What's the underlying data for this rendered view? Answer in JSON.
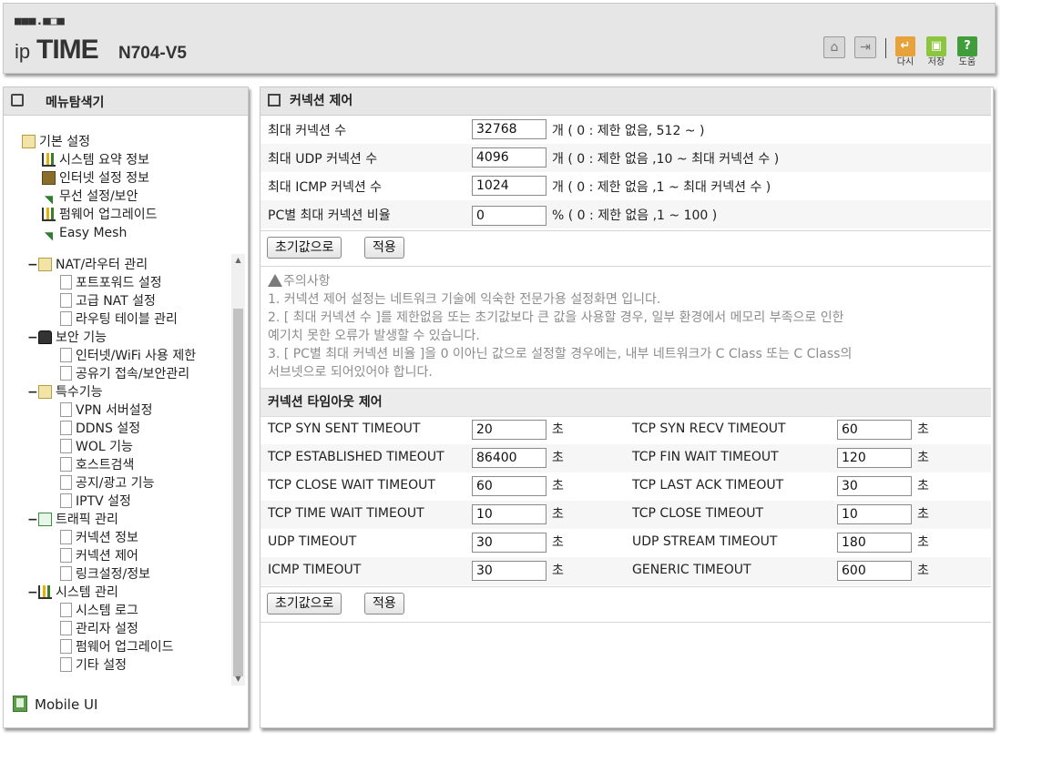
{
  "header": {
    "brand_dots": "■■■.■□■",
    "brand_ip": "ip",
    "brand_time": "TIME",
    "model": "N704-V5",
    "actions": [
      {
        "label": "다시",
        "color": "#e8a23a"
      },
      {
        "label": "저장",
        "color": "#8cc63f"
      },
      {
        "label": "도움",
        "color": "#3f9e3a"
      }
    ]
  },
  "sidebar": {
    "title": "메뉴탐색기",
    "basic": {
      "label": "기본 설정",
      "items": [
        "시스템 요약 정보",
        "인터넷 설정 정보",
        "무선 설정/보안",
        "펌웨어 업그레이드",
        "Easy Mesh"
      ]
    },
    "groups": [
      {
        "toggle": "−",
        "label": "NAT/라우터 관리",
        "items": [
          "포트포워드 설정",
          "고급 NAT 설정",
          "라우팅 테이블 관리"
        ]
      },
      {
        "toggle": "−",
        "label": "보안 기능",
        "items": [
          "인터넷/WiFi 사용 제한",
          "공유기 접속/보안관리"
        ]
      },
      {
        "toggle": "−",
        "label": "특수기능",
        "items": [
          "VPN 서버설정",
          "DDNS 설정",
          "WOL 기능",
          "호스트검색",
          "공지/광고 기능",
          "IPTV 설정"
        ]
      },
      {
        "toggle": "−",
        "label": "트래픽 관리",
        "items": [
          "커넥션 정보",
          "커넥션 제어",
          "링크설정/정보"
        ]
      },
      {
        "toggle": "−",
        "label": "시스템 관리",
        "items": [
          "시스템 로그",
          "관리자 설정",
          "펌웨어 업그레이드",
          "기타 설정"
        ]
      }
    ],
    "mobile_ui": "Mobile UI"
  },
  "main": {
    "title": "커넥션 제어",
    "limits": [
      {
        "label": "최대 커넥션 수",
        "value": "32768",
        "suffix": "개 ( 0 : 제한 없음, 512 ~ )"
      },
      {
        "label": "최대 UDP 커넥션 수",
        "value": "4096",
        "suffix": "개 ( 0 : 제한 없음 ,10 ~ 최대 커넥션 수 )"
      },
      {
        "label": "최대 ICMP 커넥션 수",
        "value": "1024",
        "suffix": "개 ( 0 : 제한 없음 ,1 ~ 최대 커넥션 수 )"
      },
      {
        "label": "PC별 최대 커넥션 비율",
        "value": "0",
        "suffix": "% ( 0 : 제한 없음 ,1 ~ 100 )"
      }
    ],
    "reset_label": "초기값으로",
    "apply_label": "적용",
    "notes_title": "주의사항",
    "notes": [
      "1.  커넥션 제어 설정는 네트워크 기술에 익숙한 전문가용 설정화면 입니다.",
      "2.  [ 최대 커넥션 수 ]를 제한없음 또는 초기값보다 큰 값을 사용할 경우, 일부 환경에서 메모리 부족으로 인한",
      "      예기치 못한 오류가 발생할 수 있습니다.",
      "3.  [ PC별 최대 커넥션 비율 ]을 0 이아닌 값으로 설정할 경우에는, 내부 네트워크가 C Class 또는 C Class의",
      "      서브넷으로 되어있어야 합니다."
    ],
    "timeout_title": "커넥션 타임아웃 제어",
    "unit": "초",
    "timeouts": [
      {
        "left": {
          "label": "TCP SYN SENT TIMEOUT",
          "value": "20"
        },
        "right": {
          "label": "TCP SYN RECV TIMEOUT",
          "value": "60"
        }
      },
      {
        "left": {
          "label": "TCP ESTABLISHED TIMEOUT",
          "value": "86400"
        },
        "right": {
          "label": "TCP FIN WAIT TIMEOUT",
          "value": "120"
        }
      },
      {
        "left": {
          "label": "TCP CLOSE WAIT TIMEOUT",
          "value": "60"
        },
        "right": {
          "label": "TCP LAST ACK TIMEOUT",
          "value": "30"
        }
      },
      {
        "left": {
          "label": "TCP TIME WAIT TIMEOUT",
          "value": "10"
        },
        "right": {
          "label": "TCP CLOSE TIMEOUT",
          "value": "10"
        }
      },
      {
        "left": {
          "label": "UDP TIMEOUT",
          "value": "30"
        },
        "right": {
          "label": "UDP STREAM TIMEOUT",
          "value": "180"
        }
      },
      {
        "left": {
          "label": "ICMP TIMEOUT",
          "value": "30"
        },
        "right": {
          "label": "GENERIC TIMEOUT",
          "value": "600"
        }
      }
    ]
  }
}
